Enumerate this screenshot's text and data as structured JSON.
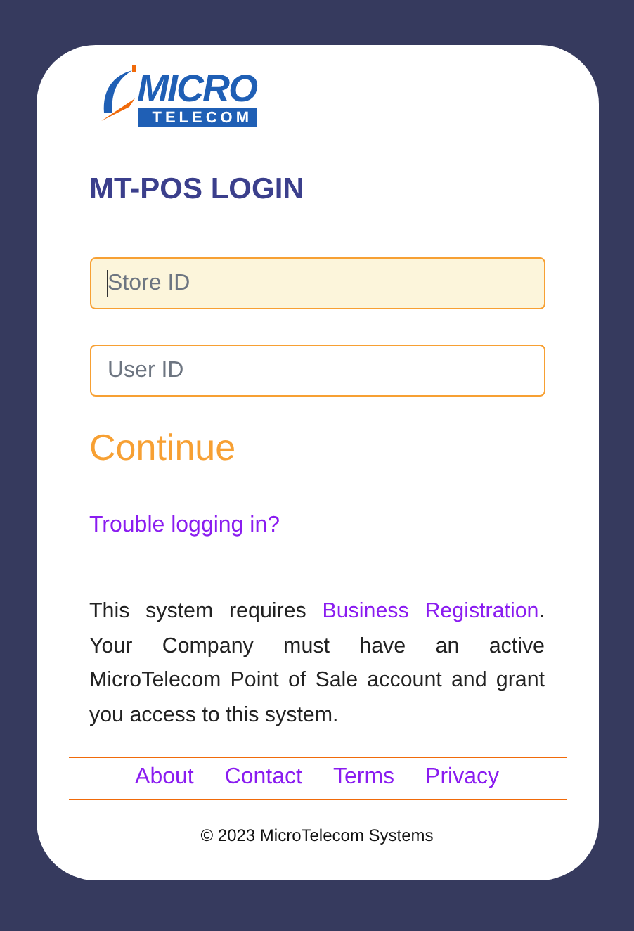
{
  "logo": {
    "word": "MICRO",
    "subword": "TELECOM"
  },
  "title": "MT-POS LOGIN",
  "fields": [
    {
      "placeholder": "Store ID",
      "focused": true
    },
    {
      "placeholder": "User ID",
      "focused": false
    }
  ],
  "continue_button": "Continue",
  "trouble_link": "Trouble logging in?",
  "notice": {
    "before": "This system requires ",
    "link": "Business Registration",
    "after": ". Your Company must have an active MicroTelecom Point of Sale account and grant you access to this system."
  },
  "footer_links": [
    "About",
    "Contact",
    "Terms",
    "Privacy"
  ],
  "copyright": "© 2023 MicroTelecom Systems"
}
